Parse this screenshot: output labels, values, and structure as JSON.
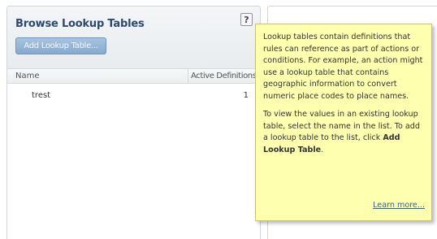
{
  "browse_panel": {
    "title": "Browse Lookup Tables",
    "help_label": "?",
    "add_button_label": "Add Lookup Table...",
    "columns": [
      "Name",
      "Active Definitions"
    ],
    "rows": [
      {
        "name": "trest",
        "active_definitions": "1"
      }
    ]
  },
  "tooltip": {
    "para1": "Lookup tables contain definitions that rules can reference as part of actions or conditions. For example, an action might use a lookup table that contains geographic information to convert numeric place codes to place names.",
    "para2_prefix": "To view the values in an existing lookup table, select the name in the list. To add a lookup table to the list, click ",
    "para2_strong": "Add Lookup Table",
    "para2_suffix": ".",
    "learn_more": "Learn more..."
  }
}
